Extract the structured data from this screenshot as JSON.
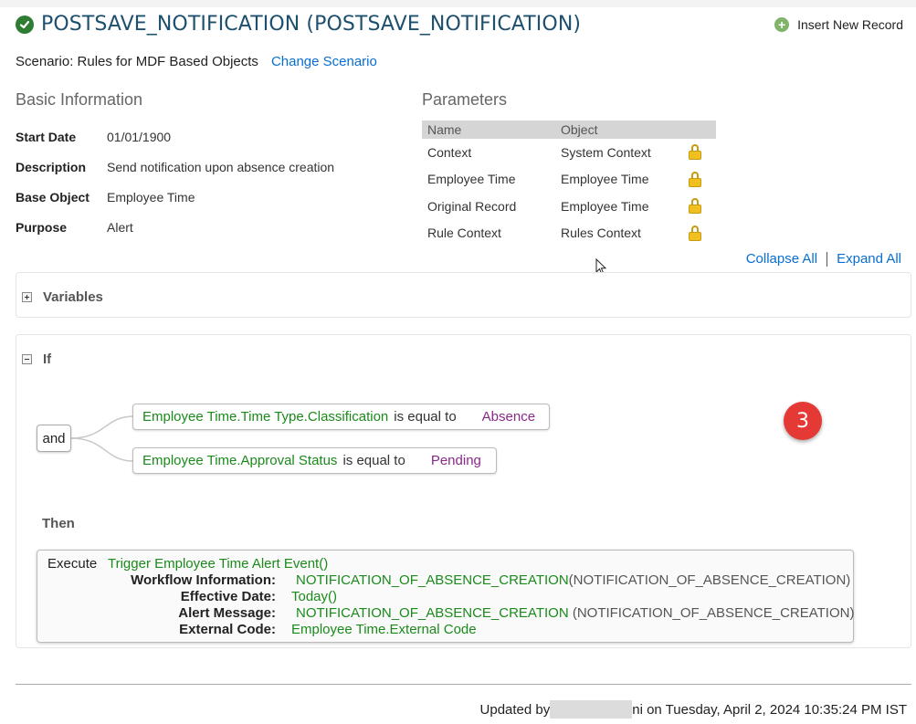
{
  "header": {
    "title": "POSTSAVE_NOTIFICATION (POSTSAVE_NOTIFICATION)",
    "insert_label": "Insert New Record"
  },
  "scenario": {
    "text": "Scenario: Rules for MDF Based Objects",
    "change_label": "Change Scenario"
  },
  "basic_info": {
    "heading": "Basic Information",
    "rows": [
      {
        "label": "Start Date",
        "value": "01/01/1900"
      },
      {
        "label": "Description",
        "value": "Send notification upon absence creation"
      },
      {
        "label": "Base Object",
        "value": "Employee Time"
      },
      {
        "label": "Purpose",
        "value": "Alert"
      }
    ]
  },
  "parameters": {
    "heading": "Parameters",
    "columns": [
      "Name",
      "Object"
    ],
    "rows": [
      {
        "name": "Context",
        "object": "System Context"
      },
      {
        "name": "Employee Time",
        "object": "Employee Time"
      },
      {
        "name": "Original Record",
        "object": "Employee Time"
      },
      {
        "name": "Rule Context",
        "object": "Rules Context"
      }
    ]
  },
  "toolbar": {
    "collapse_all": "Collapse All",
    "expand_all": "Expand All"
  },
  "variables": {
    "label": "Variables"
  },
  "if_section": {
    "label": "If",
    "connector": "and",
    "conditions": [
      {
        "field": "Employee Time.Time Type.Classification",
        "operator": "is equal to",
        "value": "Absence"
      },
      {
        "field": "Employee Time.Approval Status",
        "operator": "is equal to",
        "value": "Pending"
      }
    ]
  },
  "badge": {
    "number": "3"
  },
  "then_section": {
    "label": "Then",
    "execute_label": "Execute",
    "action": "Trigger Employee Time Alert Event()",
    "params": [
      {
        "key": "Workflow Information:",
        "value": "NOTIFICATION_OF_ABSENCE_CREATION",
        "suffix": "(NOTIFICATION_OF_ABSENCE_CREATION)"
      },
      {
        "key": "Effective Date:",
        "value": "Today()",
        "suffix": ""
      },
      {
        "key": "Alert Message:",
        "value": "NOTIFICATION_OF_ABSENCE_CREATION",
        "suffix": " (NOTIFICATION_OF_ABSENCE_CREATION)"
      },
      {
        "key": "External Code:",
        "value": "Employee Time.External Code",
        "suffix": ""
      }
    ]
  },
  "footer": {
    "prefix": "Updated by",
    "suffix": "ni on Tuesday, April 2, 2024 10:35:24 PM IST"
  },
  "icons": {
    "title_status": "check-circle-icon",
    "insert": "plus-circle-icon",
    "lock": "lock-icon",
    "expand": "plus-square-icon",
    "collapse": "minus-square-icon"
  },
  "colors": {
    "title": "#1d4f6e",
    "link": "#0a6ed1",
    "field": "#1a8a1a",
    "value": "#8a2a8a",
    "badge": "#e53935"
  }
}
